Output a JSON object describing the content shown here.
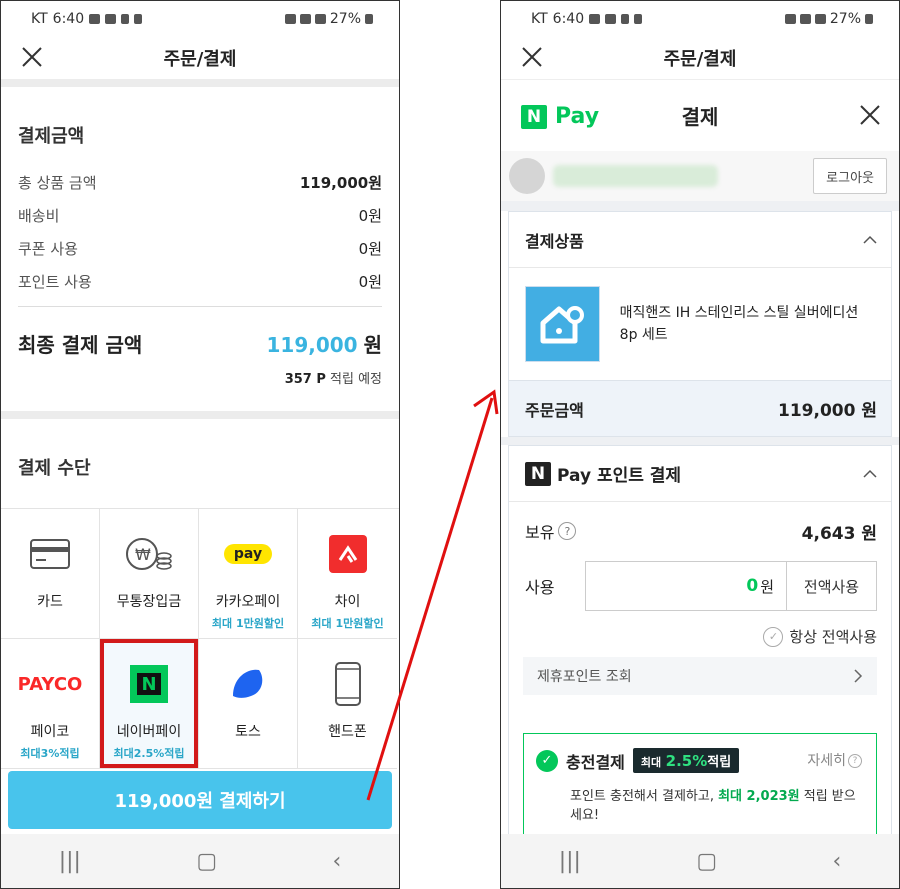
{
  "status": {
    "carrier": "KT",
    "time": "6:40",
    "battery": "27%"
  },
  "left": {
    "title": "주문/결제",
    "payment_amount": {
      "title": "결제금액",
      "rows": [
        {
          "label": "총 상품 금액",
          "value": "119,000원"
        },
        {
          "label": "배송비",
          "value": "0원"
        },
        {
          "label": "쿠폰 사용",
          "value": "0원"
        },
        {
          "label": "포인트 사용",
          "value": "0원"
        }
      ],
      "final_label": "최종 결제 금액",
      "final_amount": "119,000",
      "final_unit": "원",
      "earn_points": "357 P",
      "earn_suffix": " 적립 예정"
    },
    "methods_title": "결제 수단",
    "methods": [
      {
        "label": "카드",
        "sub": "",
        "icon": "card-icon"
      },
      {
        "label": "무통장입금",
        "sub": "",
        "icon": "bank-transfer-icon"
      },
      {
        "label": "카카오페이",
        "sub": "최대 1만원할인",
        "icon": "kakaopay-icon",
        "icon_text": "pay"
      },
      {
        "label": "차이",
        "sub": "최대 1만원할인",
        "icon": "chai-icon"
      },
      {
        "label": "페이코",
        "sub": "최대3%적립",
        "icon": "payco-icon",
        "icon_text": "PAYCO"
      },
      {
        "label": "네이버페이",
        "sub": "최대2.5%적립",
        "icon": "naverpay-icon",
        "icon_text": "N",
        "selected": true
      },
      {
        "label": "토스",
        "sub": "",
        "icon": "toss-icon"
      },
      {
        "label": "핸드폰",
        "sub": "",
        "icon": "phone-icon"
      }
    ],
    "pay_button": "119,000원 결제하기"
  },
  "right": {
    "title": "주문/결제",
    "npay": {
      "logo_n": "N",
      "logo_pay": "Pay",
      "title": "결제",
      "logout": "로그아웃"
    },
    "product_section": {
      "title": "결제상품",
      "product_name": "매직핸즈 IH 스테인리스 스틸 실버에디션 8p 세트",
      "order_amount_label": "주문금액",
      "order_amount": "119,000 원"
    },
    "point_section": {
      "title_n": "N",
      "title": "Pay 포인트 결제",
      "balance_label": "보유",
      "help": "?",
      "balance": "4,643 원",
      "use_label": "사용",
      "use_value": "0",
      "use_unit": "원",
      "use_all": "전액사용",
      "always_all": "항상 전액사용",
      "affiliate": "제휴포인트 조회"
    },
    "charge": {
      "title": "충전결제",
      "badge_prefix": "최대",
      "badge_rate": "2.5%",
      "badge_suffix": "적립",
      "detail": "자세히",
      "desc_a": "포인트 충전해서 결제하고, ",
      "desc_b": "최대 2,023원",
      "desc_c": " 적립 받으세요!"
    }
  },
  "colors": {
    "accent": "#3ab4e0",
    "naver_green": "#03c75a",
    "highlight": "#d21a1a"
  }
}
